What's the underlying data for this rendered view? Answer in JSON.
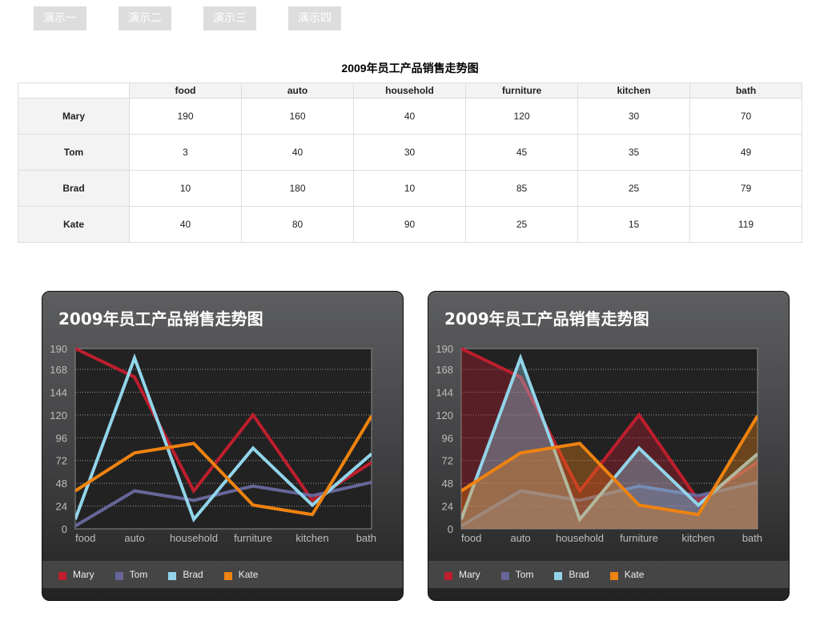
{
  "demo_buttons": [
    "演示一",
    "演示二",
    "演示三",
    "演示四"
  ],
  "table": {
    "title": "2009年员工产品销售走势图",
    "columns": [
      "food",
      "auto",
      "household",
      "furniture",
      "kitchen",
      "bath"
    ],
    "rows": [
      {
        "name": "Mary",
        "values": [
          "190",
          "160",
          "40",
          "120",
          "30",
          "70"
        ]
      },
      {
        "name": "Tom",
        "values": [
          "3",
          "40",
          "30",
          "45",
          "35",
          "49"
        ]
      },
      {
        "name": "Brad",
        "values": [
          "10",
          "180",
          "10",
          "85",
          "25",
          "79"
        ]
      },
      {
        "name": "Kate",
        "values": [
          "40",
          "80",
          "90",
          "25",
          "15",
          "119"
        ]
      }
    ]
  },
  "colors": {
    "Mary": "#be1e2d",
    "Tom": "#666699",
    "Brad": "#92d5ea",
    "Kate": "#ee8310"
  },
  "chart_data": [
    {
      "type": "line",
      "title": "2009年员工产品销售走势图",
      "categories": [
        "food",
        "auto",
        "household",
        "furniture",
        "kitchen",
        "bath"
      ],
      "yticks": [
        0,
        24,
        48,
        72,
        96,
        120,
        144,
        168,
        190
      ],
      "ylim": [
        0,
        190
      ],
      "grid": true,
      "legend": "bottom",
      "series": [
        {
          "name": "Mary",
          "values": [
            190,
            160,
            40,
            120,
            30,
            70
          ]
        },
        {
          "name": "Tom",
          "values": [
            3,
            40,
            30,
            45,
            35,
            49
          ]
        },
        {
          "name": "Brad",
          "values": [
            10,
            180,
            10,
            85,
            25,
            79
          ]
        },
        {
          "name": "Kate",
          "values": [
            40,
            80,
            90,
            25,
            15,
            119
          ]
        }
      ]
    },
    {
      "type": "area",
      "title": "2009年员工产品销售走势图",
      "categories": [
        "food",
        "auto",
        "household",
        "furniture",
        "kitchen",
        "bath"
      ],
      "yticks": [
        0,
        24,
        48,
        72,
        96,
        120,
        144,
        168,
        190
      ],
      "ylim": [
        0,
        190
      ],
      "grid": true,
      "legend": "bottom",
      "series": [
        {
          "name": "Mary",
          "values": [
            190,
            160,
            40,
            120,
            30,
            70
          ]
        },
        {
          "name": "Tom",
          "values": [
            3,
            40,
            30,
            45,
            35,
            49
          ]
        },
        {
          "name": "Brad",
          "values": [
            10,
            180,
            10,
            85,
            25,
            79
          ]
        },
        {
          "name": "Kate",
          "values": [
            40,
            80,
            90,
            25,
            15,
            119
          ]
        }
      ]
    }
  ]
}
